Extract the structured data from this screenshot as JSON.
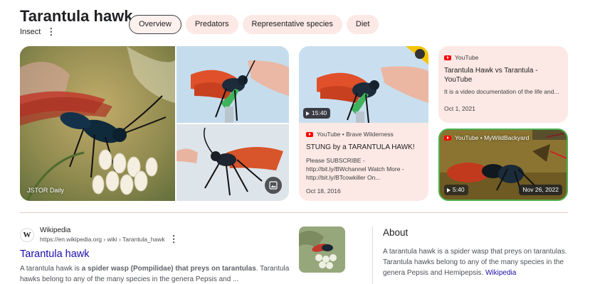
{
  "header": {
    "title": "Tarantula hawk",
    "subtitle": "Insect",
    "tabs": [
      {
        "label": "Overview",
        "active": true
      },
      {
        "label": "Predators",
        "active": false
      },
      {
        "label": "Representative species",
        "active": false
      },
      {
        "label": "Diet",
        "active": false
      }
    ]
  },
  "images": {
    "main_caption": "JSTOR Daily"
  },
  "videos": [
    {
      "channel": "YouTube • Brave Wilderness",
      "duration": "15:40",
      "title": "STUNG by a TARANTULA HAWK!",
      "description": "Please SUBSCRIBE - http://bit.ly/BWchannel Watch More - http://bit.ly/BTcowkiller On...",
      "date": "Oct 18, 2016"
    },
    {
      "channel": "YouTube",
      "title": "Tarantula Hawk vs Tarantula - YouTube",
      "description": "It is a video documentation of the life and...",
      "date": "Oct 1, 2021"
    },
    {
      "channel": "YouTube • MyWildBackyard",
      "duration": "5:40",
      "date": "Nov 26, 2022"
    }
  ],
  "result": {
    "site_name": "Wikipedia",
    "favicon_letter": "W",
    "url": "https://en.wikipedia.org › wiki › Tarantula_hawk",
    "title": "Tarantula hawk",
    "snippet_before": "A tarantula hawk is ",
    "snippet_bold": "a spider wasp (Pompilidae) that preys on tarantulas",
    "snippet_after": ". Tarantula hawks belong to any of the many species in the genera Pepsis and ..."
  },
  "about": {
    "heading": "About",
    "text": "A tarantula hawk is a spider wasp that preys on tarantulas. Tarantula hawks belong to any of the many species in the genera Pepsis and Hemipepsis.",
    "link": "Wikipedia"
  },
  "colors": {
    "chip_bg": "#fce8e4",
    "link": "#1a0dab",
    "youtube_red": "#ff0000"
  }
}
